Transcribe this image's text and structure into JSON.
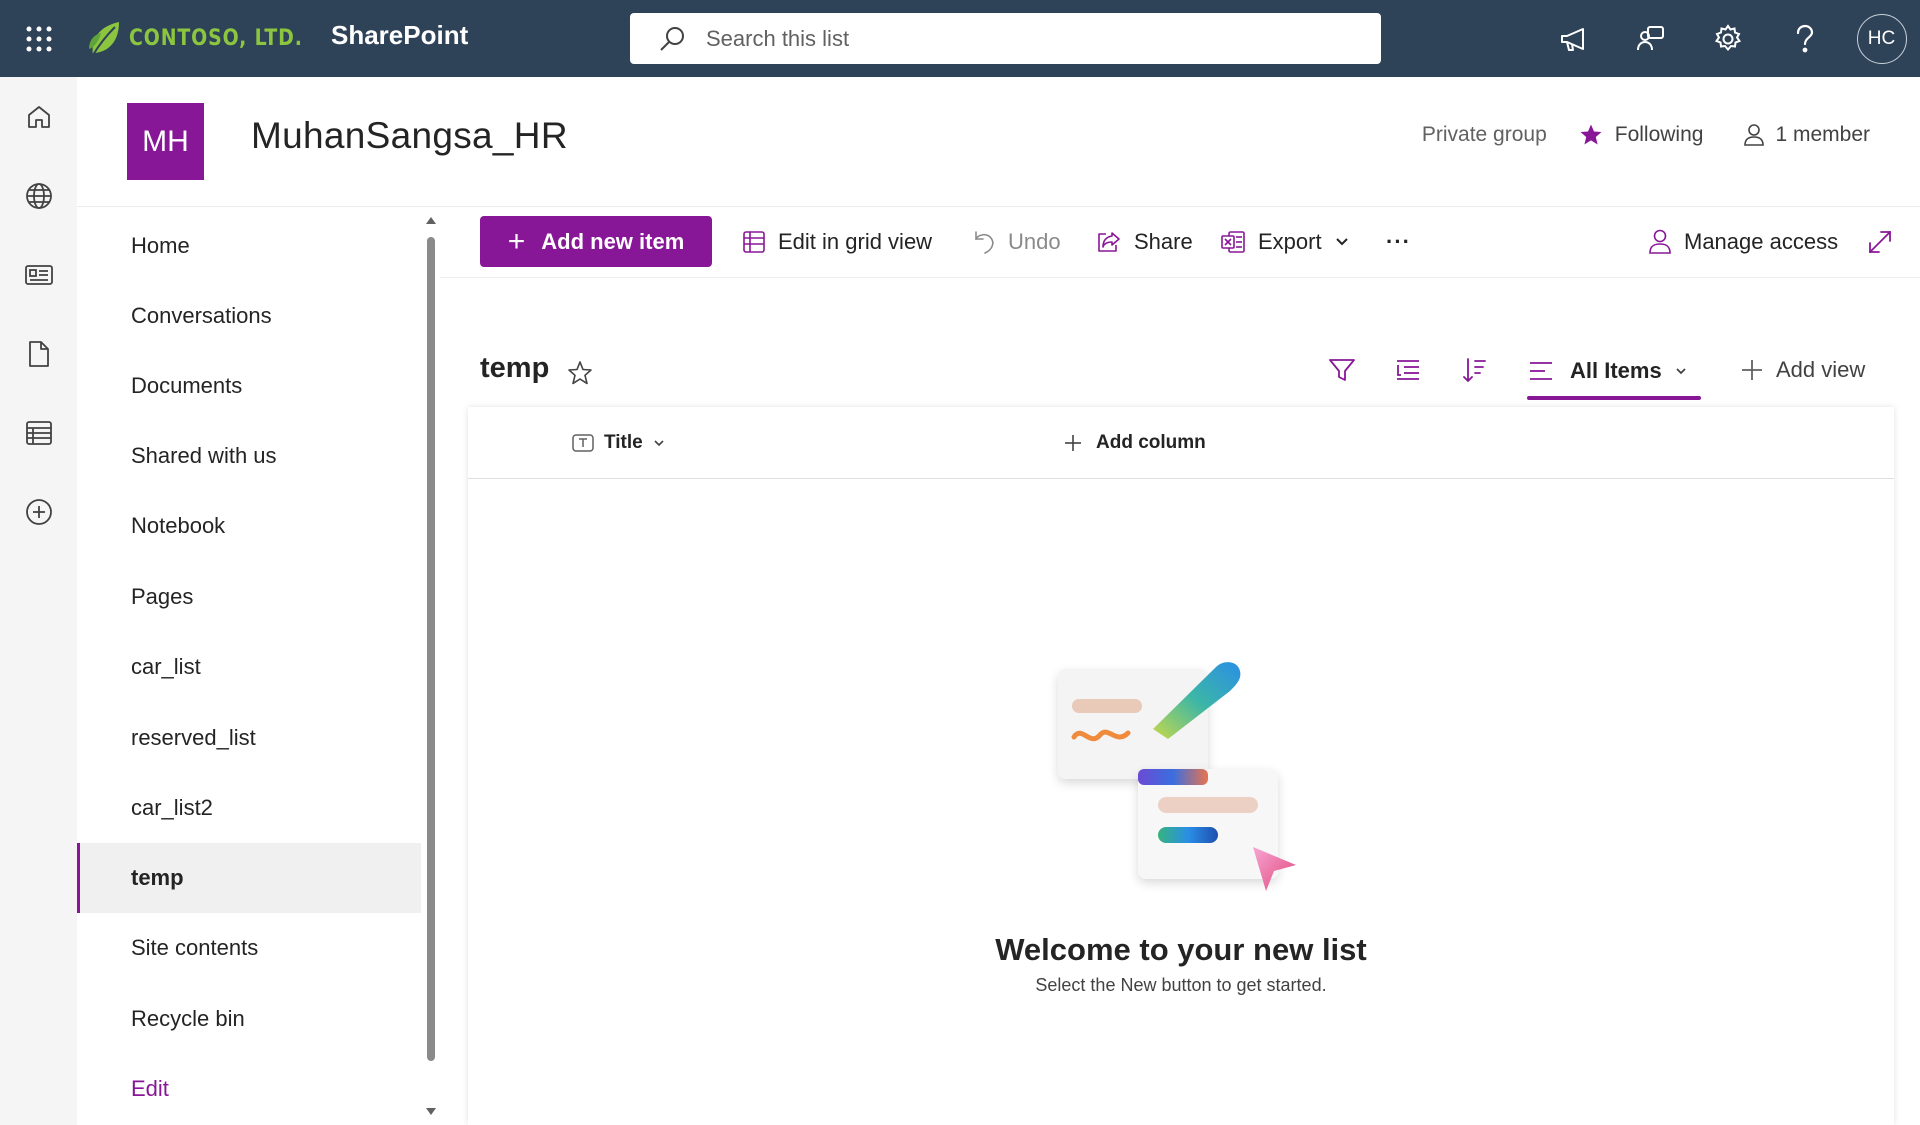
{
  "suite": {
    "company": "CONTOSO, LTD.",
    "app_name": "SharePoint",
    "search_placeholder": "Search this list",
    "avatar_initials": "HC",
    "colors": {
      "bar": "#2f4358",
      "brand": "#8cc63f"
    }
  },
  "appbar": {
    "items": [
      "home-icon",
      "globe-icon",
      "news-icon",
      "files-icon",
      "lists-icon",
      "create-icon"
    ]
  },
  "site": {
    "logo_initials": "MH",
    "title": "MuhanSangsa_HR",
    "privacy": "Private group",
    "follow_label": "Following",
    "members_label": "1 member",
    "accent": "#881798"
  },
  "nav": {
    "items": [
      {
        "label": "Home"
      },
      {
        "label": "Conversations"
      },
      {
        "label": "Documents"
      },
      {
        "label": "Shared with us"
      },
      {
        "label": "Notebook"
      },
      {
        "label": "Pages"
      },
      {
        "label": "car_list"
      },
      {
        "label": "reserved_list"
      },
      {
        "label": "car_list2"
      },
      {
        "label": "temp",
        "selected": true
      },
      {
        "label": "Site contents"
      },
      {
        "label": "Recycle bin"
      }
    ],
    "edit_label": "Edit"
  },
  "commands": {
    "new_item": "Add new item",
    "grid_view": "Edit in grid view",
    "undo": "Undo",
    "share": "Share",
    "export": "Export",
    "more": "···",
    "manage_access": "Manage access"
  },
  "view": {
    "list_title": "temp",
    "current_view": "All Items",
    "add_view": "Add view"
  },
  "grid": {
    "columns": [
      "Title"
    ],
    "add_column": "Add column",
    "empty_title": "Welcome to your new list",
    "empty_subtitle": "Select the New button to get started."
  }
}
